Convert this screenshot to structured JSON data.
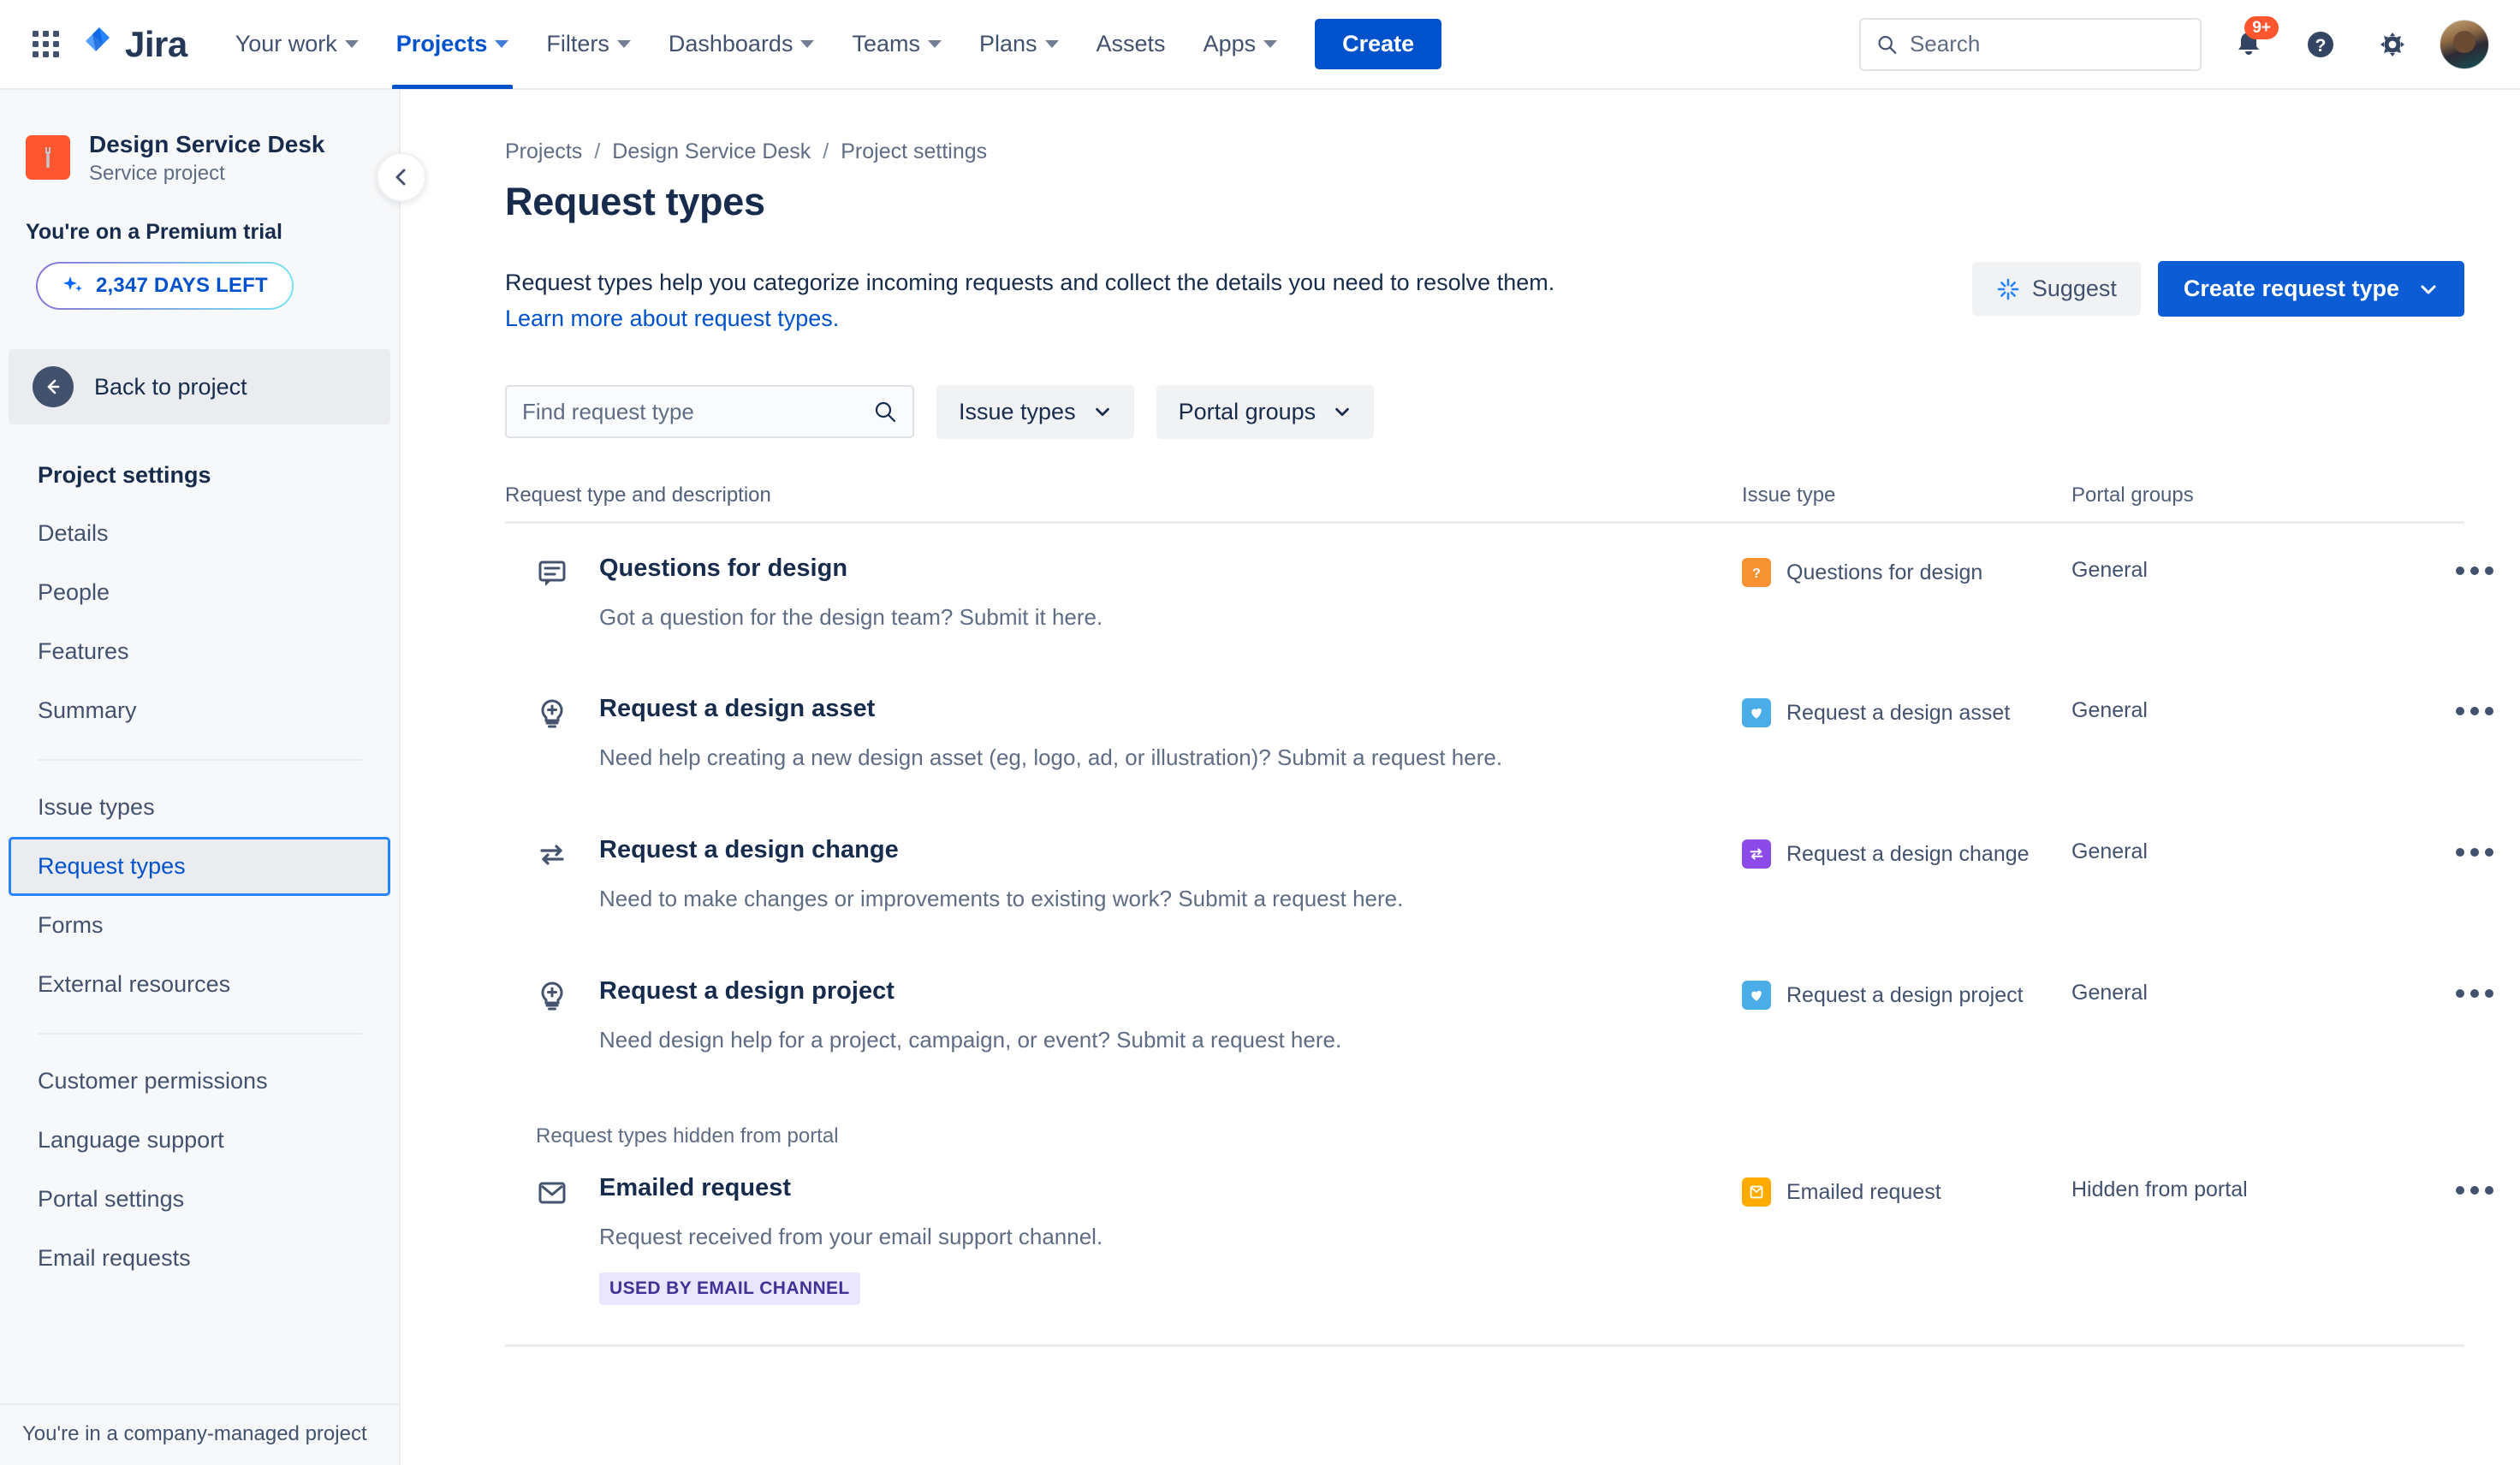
{
  "topnav": {
    "app_switcher_icon": "grid-apps-icon",
    "logo_text": "Jira",
    "items": [
      {
        "label": "Your work",
        "has_caret": true,
        "active": false
      },
      {
        "label": "Projects",
        "has_caret": true,
        "active": true
      },
      {
        "label": "Filters",
        "has_caret": true,
        "active": false
      },
      {
        "label": "Dashboards",
        "has_caret": true,
        "active": false
      },
      {
        "label": "Teams",
        "has_caret": true,
        "active": false
      },
      {
        "label": "Plans",
        "has_caret": true,
        "active": false
      },
      {
        "label": "Assets",
        "has_caret": false,
        "active": false
      },
      {
        "label": "Apps",
        "has_caret": true,
        "active": false
      }
    ],
    "create_label": "Create",
    "search": {
      "placeholder": "Search",
      "value": "",
      "icon": "search-icon"
    },
    "notifications": {
      "icon": "bell-icon",
      "badge": "9+"
    },
    "help": {
      "icon": "help-circle-icon"
    },
    "settings": {
      "icon": "gear-icon"
    },
    "avatar": {
      "icon": "user-avatar"
    }
  },
  "sidebar": {
    "project_name": "Design Service Desk",
    "project_subtitle": "Service project",
    "project_avatar_icon": "wrench-icon",
    "trial_title": "You're on a Premium trial",
    "trial_pill_label": "2,347 DAYS LEFT",
    "trial_pill_icon": "sparkle-icon",
    "back_label": "Back to project",
    "back_icon": "arrow-left-circle-icon",
    "section_title": "Project settings",
    "group1": [
      {
        "label": "Details"
      },
      {
        "label": "People"
      },
      {
        "label": "Features"
      },
      {
        "label": "Summary"
      }
    ],
    "group2": [
      {
        "label": "Issue types"
      },
      {
        "label": "Request types",
        "selected": true
      },
      {
        "label": "Forms"
      },
      {
        "label": "External resources"
      }
    ],
    "group3": [
      {
        "label": "Customer permissions"
      },
      {
        "label": "Language support"
      },
      {
        "label": "Portal settings"
      },
      {
        "label": "Email requests"
      }
    ],
    "footer_note": "You're in a company-managed project",
    "collapse_icon": "chevron-left-icon"
  },
  "main": {
    "breadcrumbs": [
      "Projects",
      "Design Service Desk",
      "Project settings"
    ],
    "breadcrumb_separator": "/",
    "page_title": "Request types",
    "suggest_label": "Suggest",
    "suggest_icon": "ai-sparkle-icon",
    "create_request_type_label": "Create request type",
    "create_request_type_caret_icon": "chevron-down-icon",
    "intro_text": "Request types help you categorize incoming requests and collect the details you need to resolve them.",
    "intro_link": "Learn more about request types.",
    "find_placeholder": "Find request type",
    "find_value": "",
    "find_icon": "search-icon",
    "filter_issue_types": "Issue types",
    "filter_portal_groups": "Portal groups",
    "filter_caret_icon": "chevron-down-icon",
    "columns": [
      "Request type and description",
      "Issue type",
      "Portal groups"
    ],
    "hidden_section_label": "Request types hidden from portal",
    "more_icon": "more-horizontal-icon",
    "rows": [
      {
        "icon": "comment-icon",
        "title": "Questions for design",
        "description": "Got a question for the design team? Submit it here.",
        "issue_type": "Questions for design",
        "issue_type_icon": "question-mark-badge",
        "issue_type_color": "#F79232",
        "portal_groups": "General"
      },
      {
        "icon": "lightbulb-plus-icon",
        "title": "Request a design asset",
        "description": "Need help creating a new design asset (eg, logo, ad, or illustration)? Submit a request here.",
        "issue_type": "Request a design asset",
        "issue_type_icon": "heart-badge",
        "issue_type_color": "#4BADE8",
        "portal_groups": "General"
      },
      {
        "icon": "exchange-arrows-icon",
        "title": "Request a design change",
        "description": "Need to make changes or improvements to existing work? Submit a request here.",
        "issue_type": "Request a design change",
        "issue_type_icon": "exchange-badge",
        "issue_type_color": "#8C4BE8",
        "portal_groups": "General"
      },
      {
        "icon": "lightbulb-plus-icon",
        "title": "Request a design project",
        "description": "Need design help for a project, campaign, or event? Submit a request here.",
        "issue_type": "Request a design project",
        "issue_type_icon": "heart-badge",
        "issue_type_color": "#4BADE8",
        "portal_groups": "General"
      }
    ],
    "hidden_rows": [
      {
        "icon": "envelope-icon",
        "title": "Emailed request",
        "description": "Request received from your email support channel.",
        "tag": "USED BY EMAIL CHANNEL",
        "issue_type": "Emailed request",
        "issue_type_icon": "envelope-badge",
        "issue_type_color": "#FFAB00",
        "portal_groups": "Hidden from portal"
      }
    ]
  },
  "colors": {
    "brand_blue": "#0052CC",
    "button_blue": "#0B5CD5",
    "text_primary": "#172B4D",
    "text_subtle": "#5E6C84",
    "border": "#EBECF0",
    "sidebar_bg": "#F7F8F9",
    "badge_red": "#FF5630",
    "tag_bg": "#EAE6FF",
    "tag_text": "#403294"
  }
}
